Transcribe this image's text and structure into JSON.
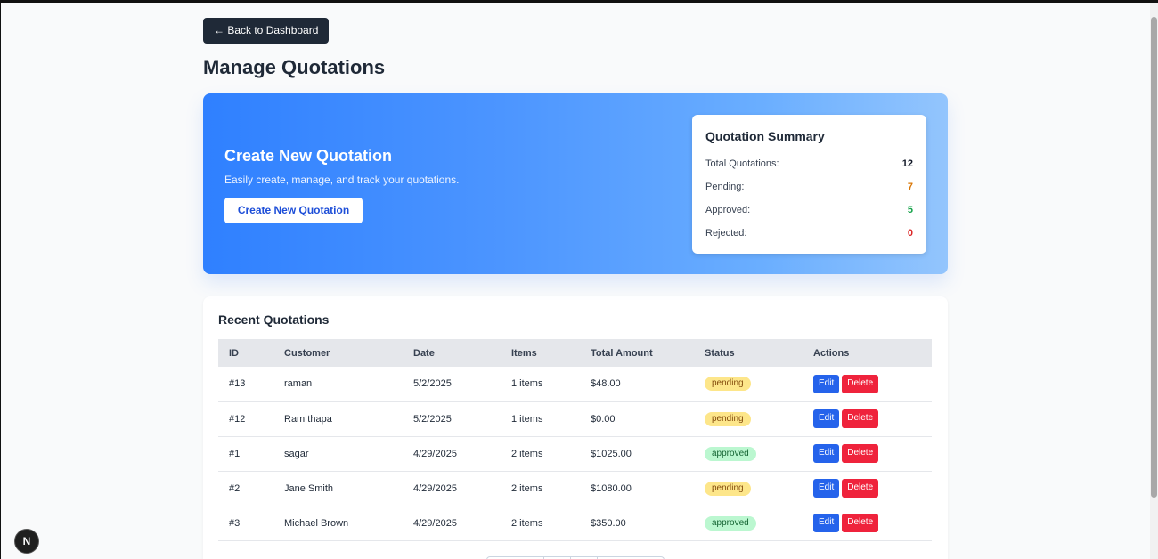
{
  "nav": {
    "back_label": "← Back to Dashboard"
  },
  "page": {
    "title": "Manage Quotations"
  },
  "hero": {
    "title": "Create New Quotation",
    "subtitle": "Easily create, manage, and track your quotations.",
    "button_label": "Create New Quotation"
  },
  "summary": {
    "title": "Quotation Summary",
    "rows": [
      {
        "label": "Total Quotations:",
        "value": "12",
        "color": "#111827"
      },
      {
        "label": "Pending:",
        "value": "7",
        "color": "#d97706"
      },
      {
        "label": "Approved:",
        "value": "5",
        "color": "#16a34a"
      },
      {
        "label": "Rejected:",
        "value": "0",
        "color": "#dc2626"
      }
    ]
  },
  "recent": {
    "title": "Recent Quotations",
    "columns": [
      "ID",
      "Customer",
      "Date",
      "Items",
      "Total Amount",
      "Status",
      "Actions"
    ],
    "rows": [
      {
        "id": "#13",
        "customer": "raman",
        "date": "5/2/2025",
        "items": "1 items",
        "total": "$48.00",
        "status": "pending"
      },
      {
        "id": "#12",
        "customer": "Ram thapa",
        "date": "5/2/2025",
        "items": "1 items",
        "total": "$0.00",
        "status": "pending"
      },
      {
        "id": "#1",
        "customer": "sagar",
        "date": "4/29/2025",
        "items": "2 items",
        "total": "$1025.00",
        "status": "approved"
      },
      {
        "id": "#2",
        "customer": "Jane Smith",
        "date": "4/29/2025",
        "items": "2 items",
        "total": "$1080.00",
        "status": "pending"
      },
      {
        "id": "#3",
        "customer": "Michael Brown",
        "date": "4/29/2025",
        "items": "2 items",
        "total": "$350.00",
        "status": "approved"
      }
    ],
    "edit_label": "Edit",
    "delete_label": "Delete"
  },
  "dev_badge": {
    "label": "N",
    "icon": "nextjs-icon"
  }
}
